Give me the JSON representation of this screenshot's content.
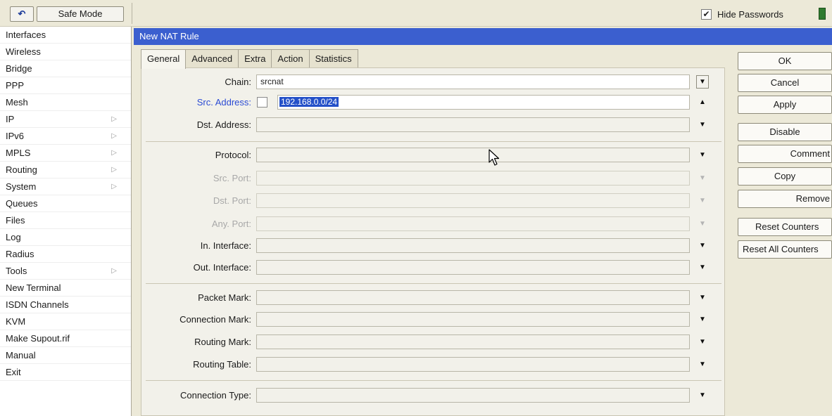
{
  "toolbar": {
    "undo_icon": "undo-icon",
    "safe_mode_label": "Safe Mode",
    "hide_passwords_label": "Hide Passwords",
    "hide_passwords_checked": true,
    "check_glyph": "✔"
  },
  "sidebar": {
    "items": [
      {
        "label": "Interfaces",
        "submenu": false
      },
      {
        "label": "Wireless",
        "submenu": false
      },
      {
        "label": "Bridge",
        "submenu": false
      },
      {
        "label": "PPP",
        "submenu": false
      },
      {
        "label": "Mesh",
        "submenu": false
      },
      {
        "label": "IP",
        "submenu": true
      },
      {
        "label": "IPv6",
        "submenu": true
      },
      {
        "label": "MPLS",
        "submenu": true
      },
      {
        "label": "Routing",
        "submenu": true
      },
      {
        "label": "System",
        "submenu": true
      },
      {
        "label": "Queues",
        "submenu": false
      },
      {
        "label": "Files",
        "submenu": false
      },
      {
        "label": "Log",
        "submenu": false
      },
      {
        "label": "Radius",
        "submenu": false
      },
      {
        "label": "Tools",
        "submenu": true
      },
      {
        "label": "New Terminal",
        "submenu": false
      },
      {
        "label": "ISDN Channels",
        "submenu": false
      },
      {
        "label": "KVM",
        "submenu": false
      },
      {
        "label": "Make Supout.rif",
        "submenu": false
      },
      {
        "label": "Manual",
        "submenu": false
      },
      {
        "label": "Exit",
        "submenu": false
      }
    ],
    "submenu_glyph": "▷"
  },
  "dialog": {
    "title": "New NAT Rule",
    "tabs": [
      "General",
      "Advanced",
      "Extra",
      "Action",
      "Statistics"
    ],
    "active_tab": "General",
    "fields": {
      "chain": {
        "label": "Chain:",
        "value": "srcnat"
      },
      "src_address": {
        "label": "Src. Address:",
        "value": "192.168.0.0/24"
      },
      "dst_address": {
        "label": "Dst. Address:",
        "value": ""
      },
      "protocol": {
        "label": "Protocol:",
        "value": ""
      },
      "src_port": {
        "label": "Src. Port:",
        "value": ""
      },
      "dst_port": {
        "label": "Dst. Port:",
        "value": ""
      },
      "any_port": {
        "label": "Any. Port:",
        "value": ""
      },
      "in_interface": {
        "label": "In. Interface:",
        "value": ""
      },
      "out_interface": {
        "label": "Out. Interface:",
        "value": ""
      },
      "packet_mark": {
        "label": "Packet Mark:",
        "value": ""
      },
      "connection_mark": {
        "label": "Connection Mark:",
        "value": ""
      },
      "routing_mark": {
        "label": "Routing Mark:",
        "value": ""
      },
      "routing_table": {
        "label": "Routing Table:",
        "value": ""
      },
      "connection_type": {
        "label": "Connection Type:",
        "value": ""
      }
    },
    "buttons": {
      "ok": "OK",
      "cancel": "Cancel",
      "apply": "Apply",
      "disable": "Disable",
      "comment": "Comment",
      "copy": "Copy",
      "remove": "Remove",
      "reset_counters": "Reset Counters",
      "reset_all_counters": "Reset All Counters"
    },
    "glyphs": {
      "down": "▼",
      "up": "▲",
      "dropdown_boxed": "▼"
    }
  },
  "colors": {
    "title_bar": "#3b5fcf",
    "selection": "#2450c8",
    "link_label": "#2b4bd4",
    "window_bg": "#ece9d8"
  }
}
